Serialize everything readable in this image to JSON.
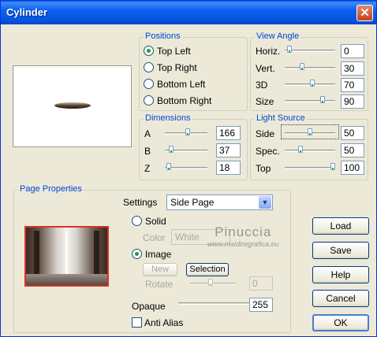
{
  "window": {
    "title": "Cylinder"
  },
  "positions": {
    "legend": "Positions",
    "options": [
      "Top Left",
      "Top Right",
      "Bottom Left",
      "Bottom Right"
    ],
    "selected": "Top Left"
  },
  "view_angle": {
    "legend": "View Angle",
    "rows": [
      {
        "label": "Horiz.",
        "value": "0",
        "level": 0.05
      },
      {
        "label": "Vert.",
        "value": "30",
        "level": 0.33
      },
      {
        "label": "3D",
        "value": "70",
        "level": 0.55
      },
      {
        "label": "Size",
        "value": "90",
        "level": 0.78
      }
    ]
  },
  "dimensions": {
    "legend": "Dimensions",
    "rows": [
      {
        "label": "A",
        "value": "166",
        "level": 0.55
      },
      {
        "label": "B",
        "value": "37",
        "level": 0.1
      },
      {
        "label": "Z",
        "value": "18",
        "level": 0.05
      }
    ]
  },
  "light_source": {
    "legend": "Light Source",
    "rows": [
      {
        "label": "Side",
        "value": "50",
        "level": 0.5
      },
      {
        "label": "Spec.",
        "value": "50",
        "level": 0.3
      },
      {
        "label": "Top",
        "value": "100",
        "level": 1.0
      }
    ]
  },
  "page_properties": {
    "legend": "Page Properties",
    "settings_label": "Settings",
    "settings_value": "Side Page",
    "solid_label": "Solid",
    "color_label": "Color",
    "color_value": "White",
    "image_label": "Image",
    "image_selected": true,
    "new_button": "New",
    "selection_button": "Selection",
    "rotate_label": "Rotate",
    "rotate_value": "0",
    "opaque_label": "Opaque",
    "opaque_value": "255",
    "opaque_level": 1.0,
    "anti_alias_label": "Anti Alias",
    "anti_alias_checked": false
  },
  "buttons": {
    "load": "Load",
    "save": "Save",
    "help": "Help",
    "cancel": "Cancel",
    "ok": "OK"
  },
  "watermark": {
    "line1": "Pinuccia",
    "line2": "www.maidiregrafica.eu"
  },
  "colors": {
    "title_bar": "#0553e0",
    "legend": "#0046d5",
    "thumbnail_border": "#d9322a"
  },
  "icons": {
    "close": "close-icon",
    "dropdown": "chevron-down-icon"
  }
}
